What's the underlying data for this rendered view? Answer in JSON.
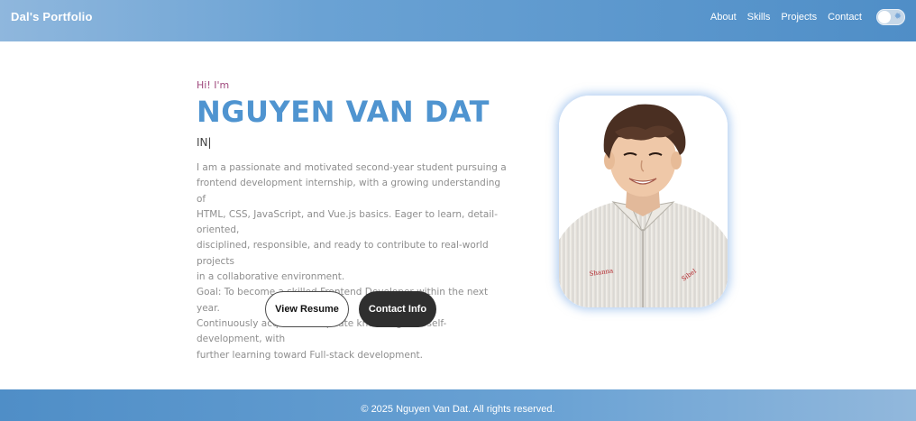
{
  "header": {
    "brand": "Dal's Portfolio",
    "nav": [
      "About",
      "Skills",
      "Projects",
      "Contact"
    ],
    "theme_toggle_icon": "sun-icon"
  },
  "hero": {
    "greeting": "Hi! I'm",
    "name": "NGUYEN VAN DAT",
    "typed_text": "IN|",
    "description": [
      "I am a passionate and motivated second-year student pursuing a",
      "frontend development internship, with a growing understanding of",
      "HTML, CSS, JavaScript, and Vue.js basics. Eager to learn, detail-oriented,",
      "disciplined, responsible, and ready to contribute to real-world projects",
      "in a collaborative environment.",
      "Goal: To become a skilled Frontend Developer within the next year.",
      "Continuously acquire and update knowledge for self-development, with",
      "further learning toward Full-stack development."
    ],
    "view_resume": "View Resume",
    "contact_info": "Contact Info"
  },
  "footer": {
    "copyright": "© 2025 Nguyen Van Dat. All rights reserved."
  },
  "colors": {
    "accent": "#4f94d0",
    "greeting": "#a04a7e",
    "dark_button": "#2f2f2f"
  }
}
